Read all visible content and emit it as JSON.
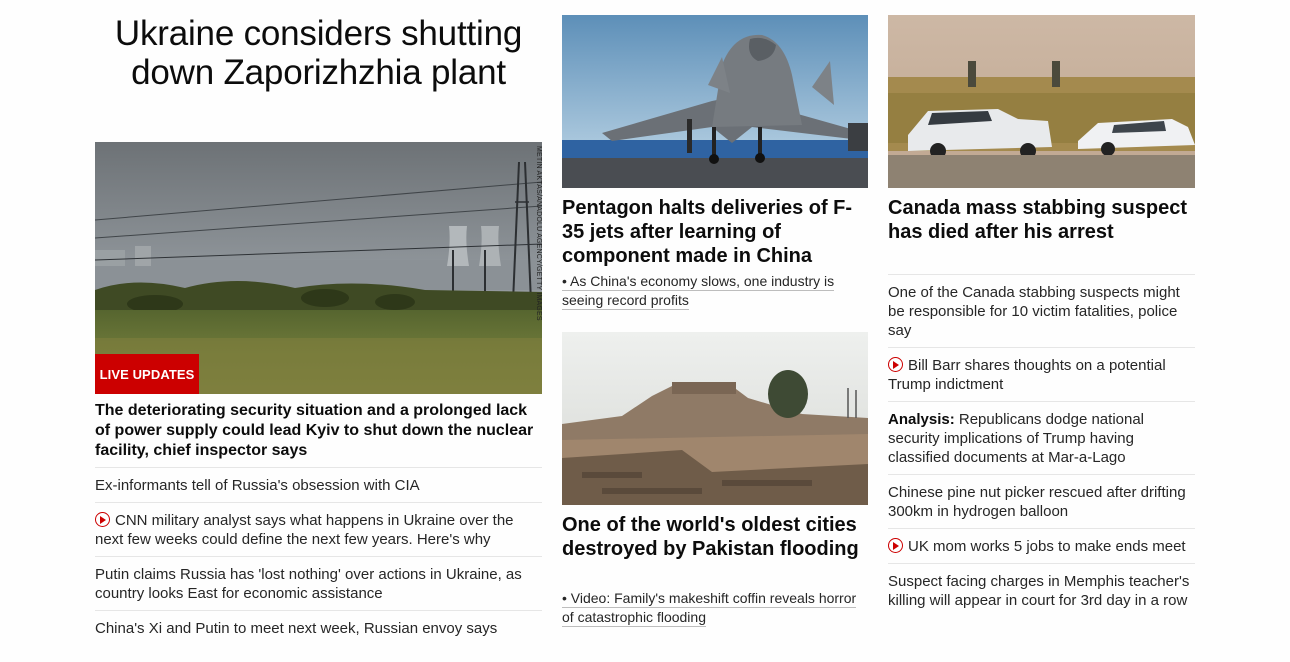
{
  "lead": {
    "headline": "Ukraine considers shutting down Zaporizhzhia plant",
    "badge": "LIVE UPDATES",
    "photo_credit": "METIN AKTAS/ANADOLU AGENCY/GETTY IMAGES",
    "dek": "The deteriorating security situation and a prolonged lack of power supply could lead Kyiv to shut down the nuclear facility, chief inspector says",
    "related": [
      {
        "text": "Ex-informants tell of Russia's obsession with CIA",
        "video": false
      },
      {
        "text": "CNN military analyst says what happens in Ukraine over the next few weeks could define the next few years. Here's why",
        "video": true
      },
      {
        "text": "Putin claims Russia has 'lost nothing' over actions in Ukraine, as country looks East for economic assistance",
        "video": false
      },
      {
        "text": "China's Xi and Putin to meet next week, Russian envoy says",
        "video": false
      }
    ]
  },
  "middle": {
    "story1": {
      "headline": "Pentagon halts deliveries of F-35 jets after learning of component made in China",
      "sub": "• As China's economy slows, one industry is seeing record profits"
    },
    "story2": {
      "headline": "One of the world's oldest cities destroyed by Pakistan flooding",
      "sub": "• Video: Family's makeshift coffin reveals horror of catastrophic flooding"
    }
  },
  "right": {
    "headline": "Canada mass stabbing suspect has died after his arrest",
    "list": [
      {
        "text": "One of the Canada stabbing suspects might be responsible for 10 victim fatalities, police say",
        "video": false
      },
      {
        "text": "Bill Barr shares thoughts on a potential Trump indictment",
        "video": true
      },
      {
        "prefix": "Analysis:",
        "text": " Republicans dodge national security implications of Trump having classified documents at Mar-a-Lago",
        "video": false
      },
      {
        "text": "Chinese pine nut picker rescued after drifting 300km in hydrogen balloon",
        "video": false
      },
      {
        "text": "UK mom works 5 jobs to make ends meet",
        "video": true
      },
      {
        "text": "Suspect facing charges in Memphis teacher's killing will appear in court for 3rd day in a row",
        "video": false
      }
    ]
  },
  "colors": {
    "accent_red": "#cc0000",
    "divider": "#e6e6e6"
  }
}
